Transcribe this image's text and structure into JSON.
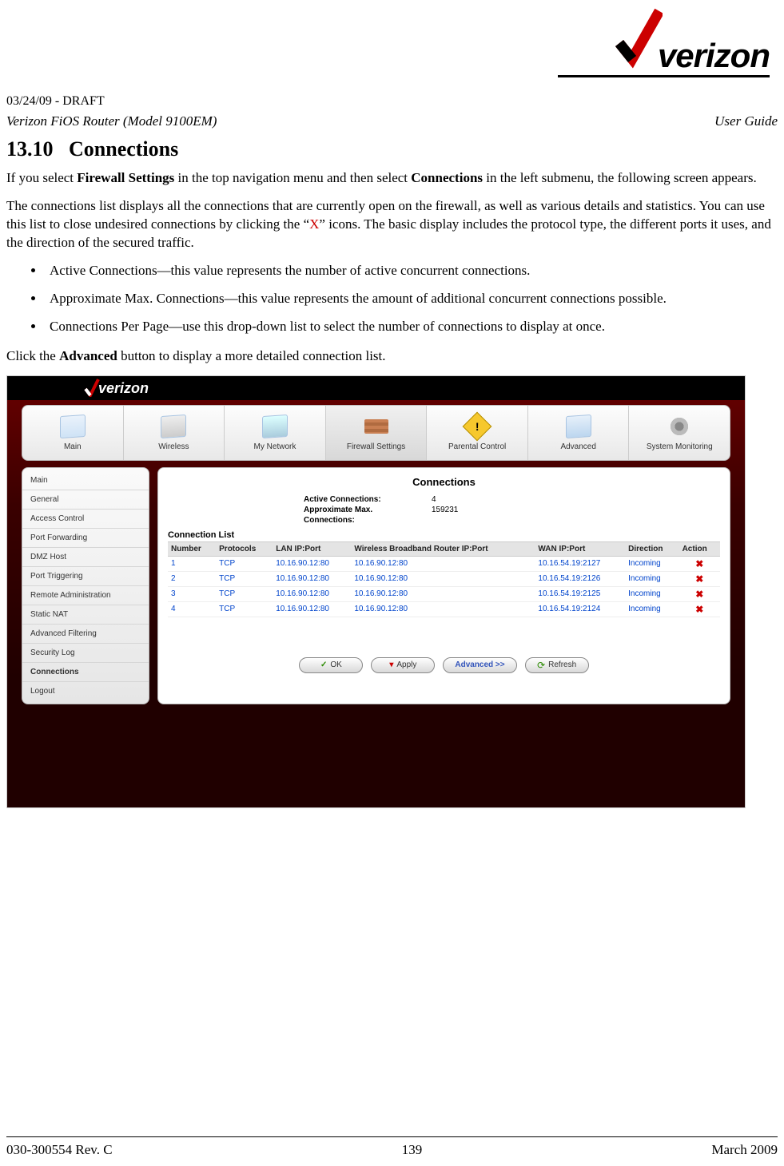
{
  "header": {
    "draft": "03/24/09 - DRAFT",
    "model_line": "Verizon FiOS Router (Model 9100EM)",
    "right_label": "User Guide",
    "logo_text": "verizon"
  },
  "section": {
    "number": "13.10",
    "title": "Connections"
  },
  "para_intro_1a": "If you select ",
  "para_intro_1b": "Firewall Settings",
  "para_intro_1c": " in the top navigation menu and then select ",
  "para_intro_1d": "Connections",
  "para_intro_1e": " in the left submenu, the following screen appears.",
  "para_intro_2a": "The connections list displays all the connections that are currently open on the firewall, as well as various details and statistics. You can use this list to close undesired connections by clicking the “",
  "para_intro_2b": "X",
  "para_intro_2c": "” icons. The basic display includes the protocol type, the different ports it uses, and the direction of the secured traffic.",
  "bullets": [
    "Active Connections—this value represents the number of active concurrent connections.",
    "Approximate Max. Connections—this value represents the amount of additional concurrent connections possible.",
    "Connections Per Page—use this drop-down list to select the number of connections to display at once."
  ],
  "para_after_a": "Click the ",
  "para_after_b": "Advanced",
  "para_after_c": " button to display a more detailed connection list.",
  "screenshot": {
    "logo_text": "verizon",
    "tabs": [
      "Main",
      "Wireless",
      "My Network",
      "Firewall Settings",
      "Parental Control",
      "Advanced",
      "System Monitoring"
    ],
    "active_tab_index": 3,
    "sidebar": [
      "Main",
      "General",
      "Access Control",
      "Port Forwarding",
      "DMZ Host",
      "Port Triggering",
      "Remote Administration",
      "Static NAT",
      "Advanced Filtering",
      "Security Log",
      "Connections",
      "Logout"
    ],
    "active_sidebar_index": 10,
    "panel_title": "Connections",
    "stats": {
      "active_label": "Active Connections:",
      "active_value": "4",
      "approx_label1": "Approximate Max.",
      "approx_label2": "Connections:",
      "approx_value": "159231"
    },
    "list_heading": "Connection List",
    "columns": [
      "Number",
      "Protocols",
      "LAN IP:Port",
      "Wireless Broadband Router IP:Port",
      "WAN IP:Port",
      "Direction",
      "Action"
    ],
    "rows": [
      {
        "number": "1",
        "proto": "TCP",
        "lan": "10.16.90.12:80",
        "router": "10.16.90.12:80",
        "wan": "10.16.54.19:2127",
        "dir": "Incoming"
      },
      {
        "number": "2",
        "proto": "TCP",
        "lan": "10.16.90.12:80",
        "router": "10.16.90.12:80",
        "wan": "10.16.54.19:2126",
        "dir": "Incoming"
      },
      {
        "number": "3",
        "proto": "TCP",
        "lan": "10.16.90.12:80",
        "router": "10.16.90.12:80",
        "wan": "10.16.54.19:2125",
        "dir": "Incoming"
      },
      {
        "number": "4",
        "proto": "TCP",
        "lan": "10.16.90.12:80",
        "router": "10.16.90.12:80",
        "wan": "10.16.54.19:2124",
        "dir": "Incoming"
      }
    ],
    "buttons": {
      "ok": "OK",
      "apply": "Apply",
      "advanced": "Advanced >>",
      "refresh": "Refresh"
    }
  },
  "footer": {
    "left": "030-300554 Rev. C",
    "center": "139",
    "right": "March 2009"
  }
}
